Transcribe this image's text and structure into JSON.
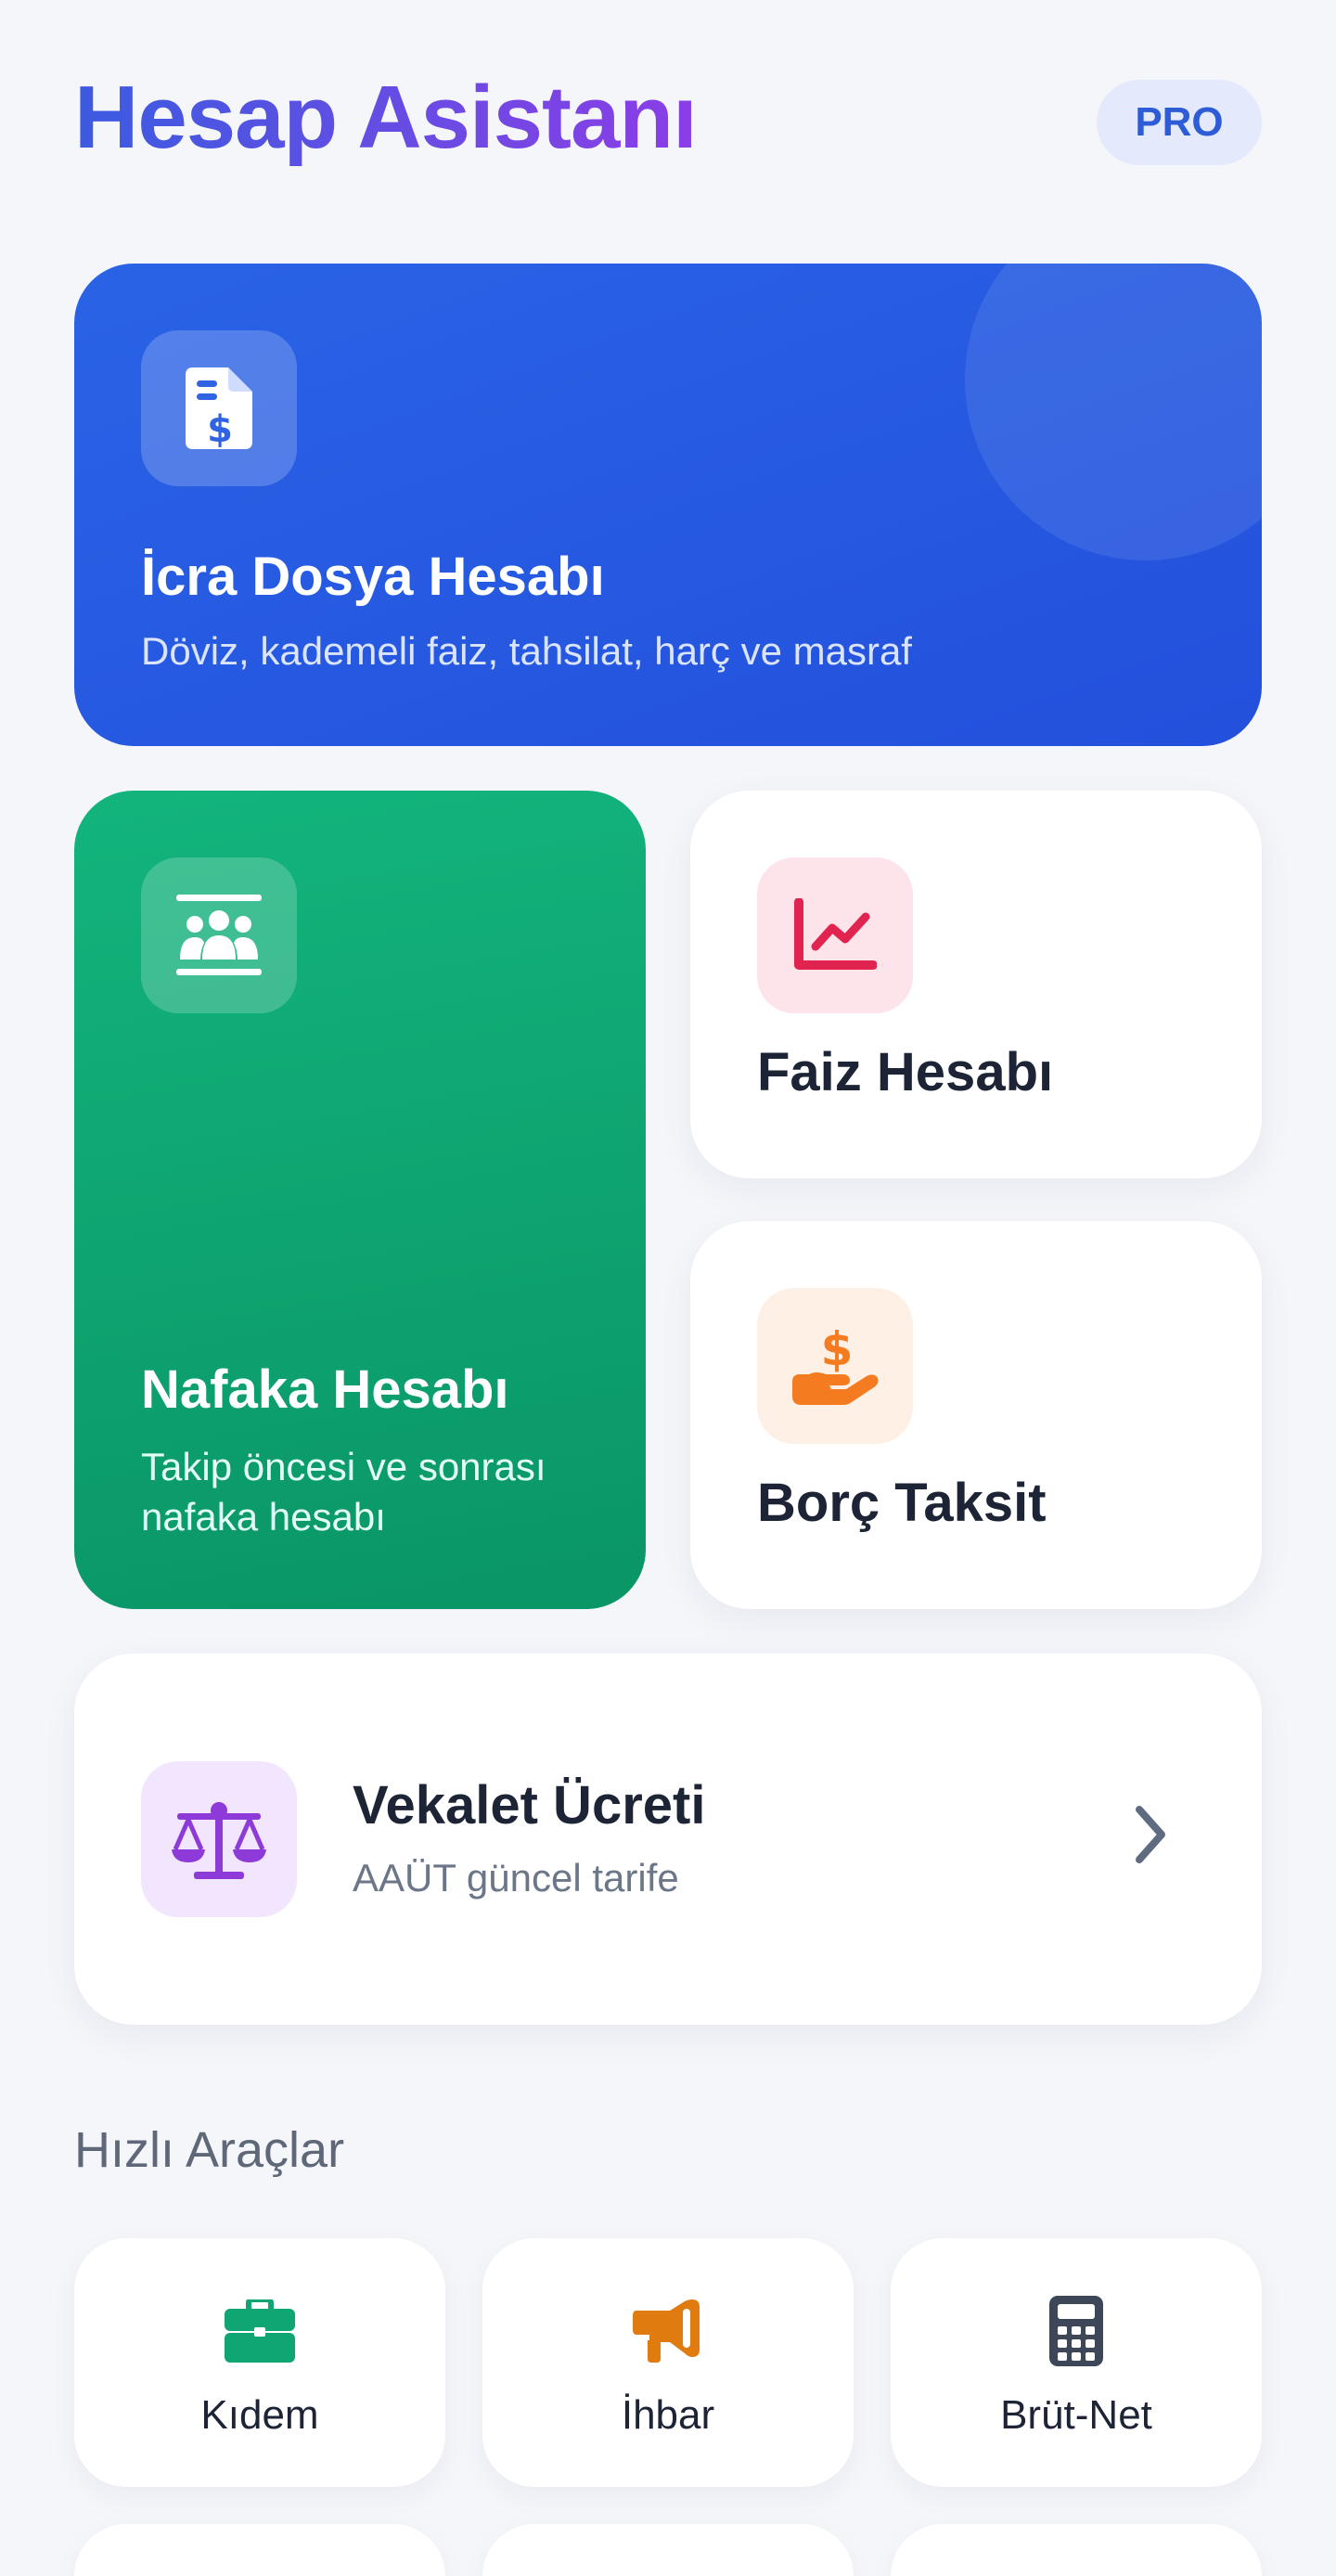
{
  "header": {
    "title": "Hesap Asistanı",
    "badge": "PRO"
  },
  "cards": {
    "icra": {
      "title": "İcra Dosya Hesabı",
      "subtitle": "Döviz, kademeli faiz, tahsilat, harç ve masraf",
      "icon": "file-invoice-dollar-icon",
      "color": "#2a63e6"
    },
    "nafaka": {
      "title": "Nafaka Hesabı",
      "subtitle": "Takip öncesi ve sonrası nafaka hesabı",
      "icon": "people-group-icon",
      "color": "#10a673"
    },
    "faiz": {
      "title": "Faiz Hesabı",
      "icon": "chart-line-icon",
      "color": "#e0244f"
    },
    "borc": {
      "title": "Borç Taksit",
      "icon": "hand-holding-dollar-icon",
      "color": "#f47b20"
    },
    "vekalet": {
      "title": "Vekalet Ücreti",
      "subtitle": "AAÜT güncel tarife",
      "icon": "scale-balanced-icon",
      "color": "#8d3ad8"
    }
  },
  "quick_tools": {
    "title": "Hızlı Araçlar",
    "items": [
      {
        "label": "Kıdem",
        "icon": "briefcase-icon",
        "color": "#10a673"
      },
      {
        "label": "İhbar",
        "icon": "bullhorn-icon",
        "color": "#e07b10"
      },
      {
        "label": "Brüt-Net",
        "icon": "calculator-icon",
        "color": "#3d4757"
      }
    ]
  }
}
